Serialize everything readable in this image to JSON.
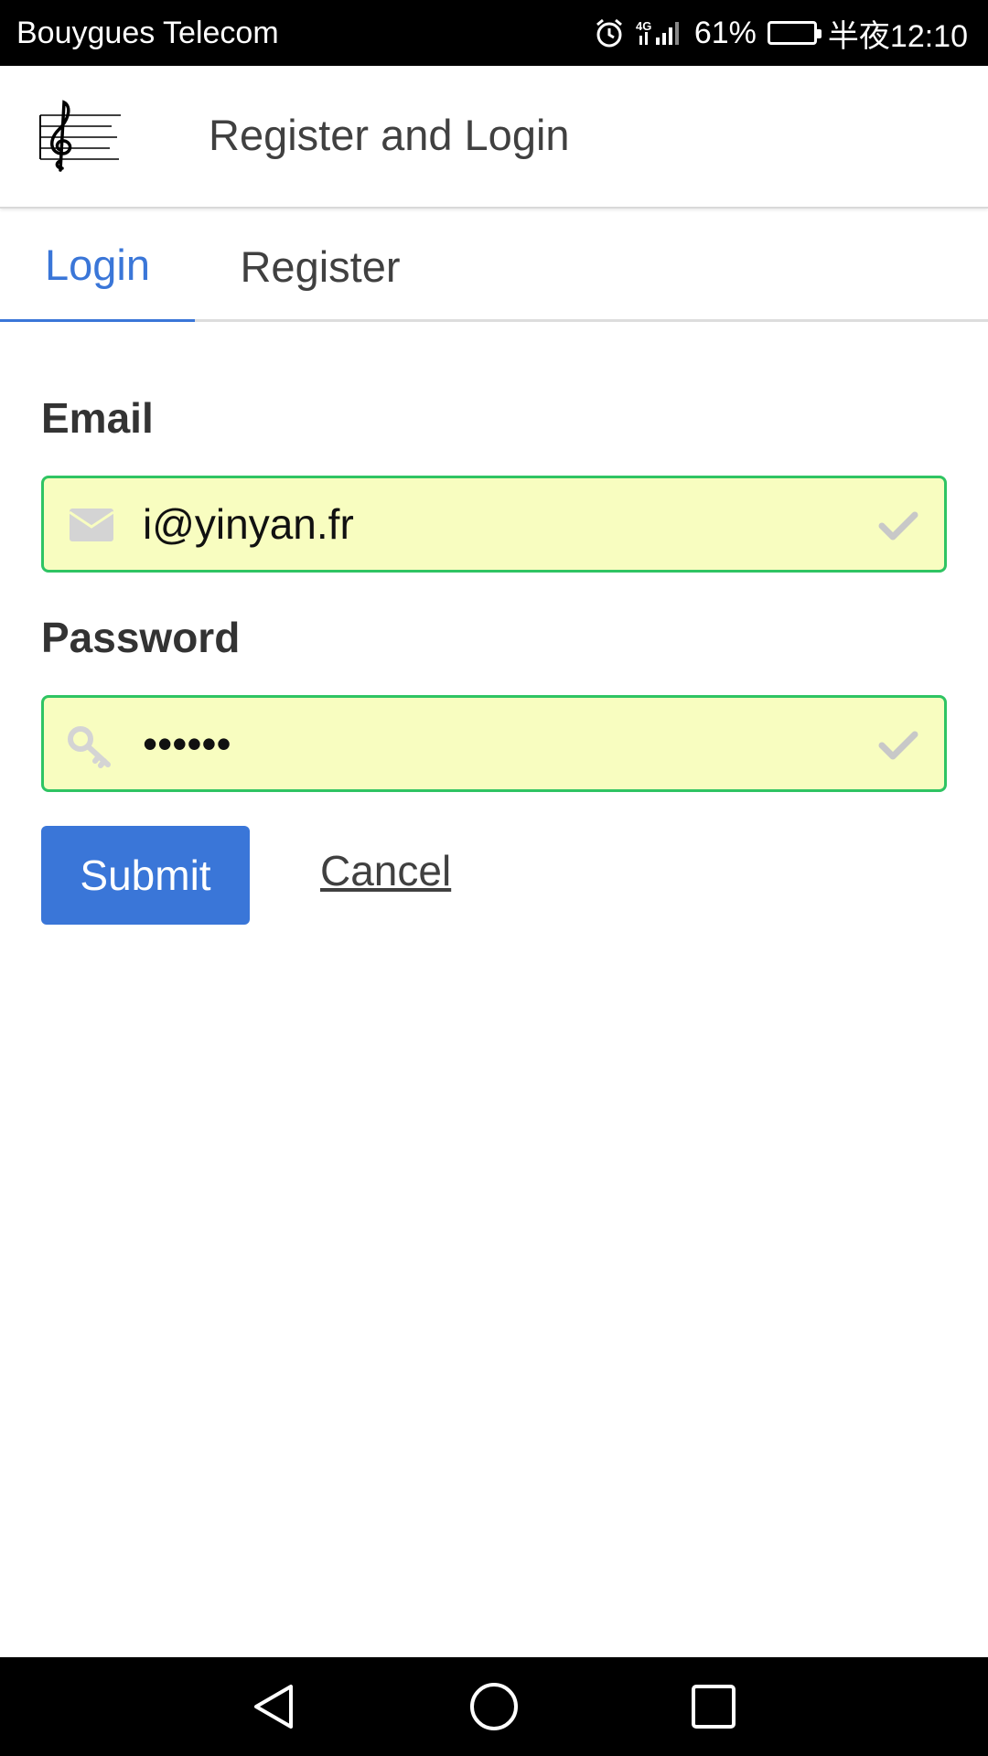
{
  "status_bar": {
    "carrier": "Bouygues Telecom",
    "network": "4G",
    "battery": "61%",
    "battery_level": 0.61,
    "time": "半夜12:10"
  },
  "header": {
    "title": "Register and Login",
    "logo_icon": "treble-clef-icon"
  },
  "tabs": [
    {
      "label": "Login",
      "active": true
    },
    {
      "label": "Register",
      "active": false
    }
  ],
  "form": {
    "email_label": "Email",
    "email_value": "i@yinyan.fr",
    "password_label": "Password",
    "password_value": "••••••",
    "submit_label": "Submit",
    "cancel_label": "Cancel"
  },
  "colors": {
    "accent": "#3a76d8",
    "field_background": "#f8fdc0",
    "valid_border": "#2fc463"
  },
  "nav": {
    "back_icon": "back-triangle-icon",
    "home_icon": "home-circle-icon",
    "recents_icon": "recents-square-icon"
  }
}
